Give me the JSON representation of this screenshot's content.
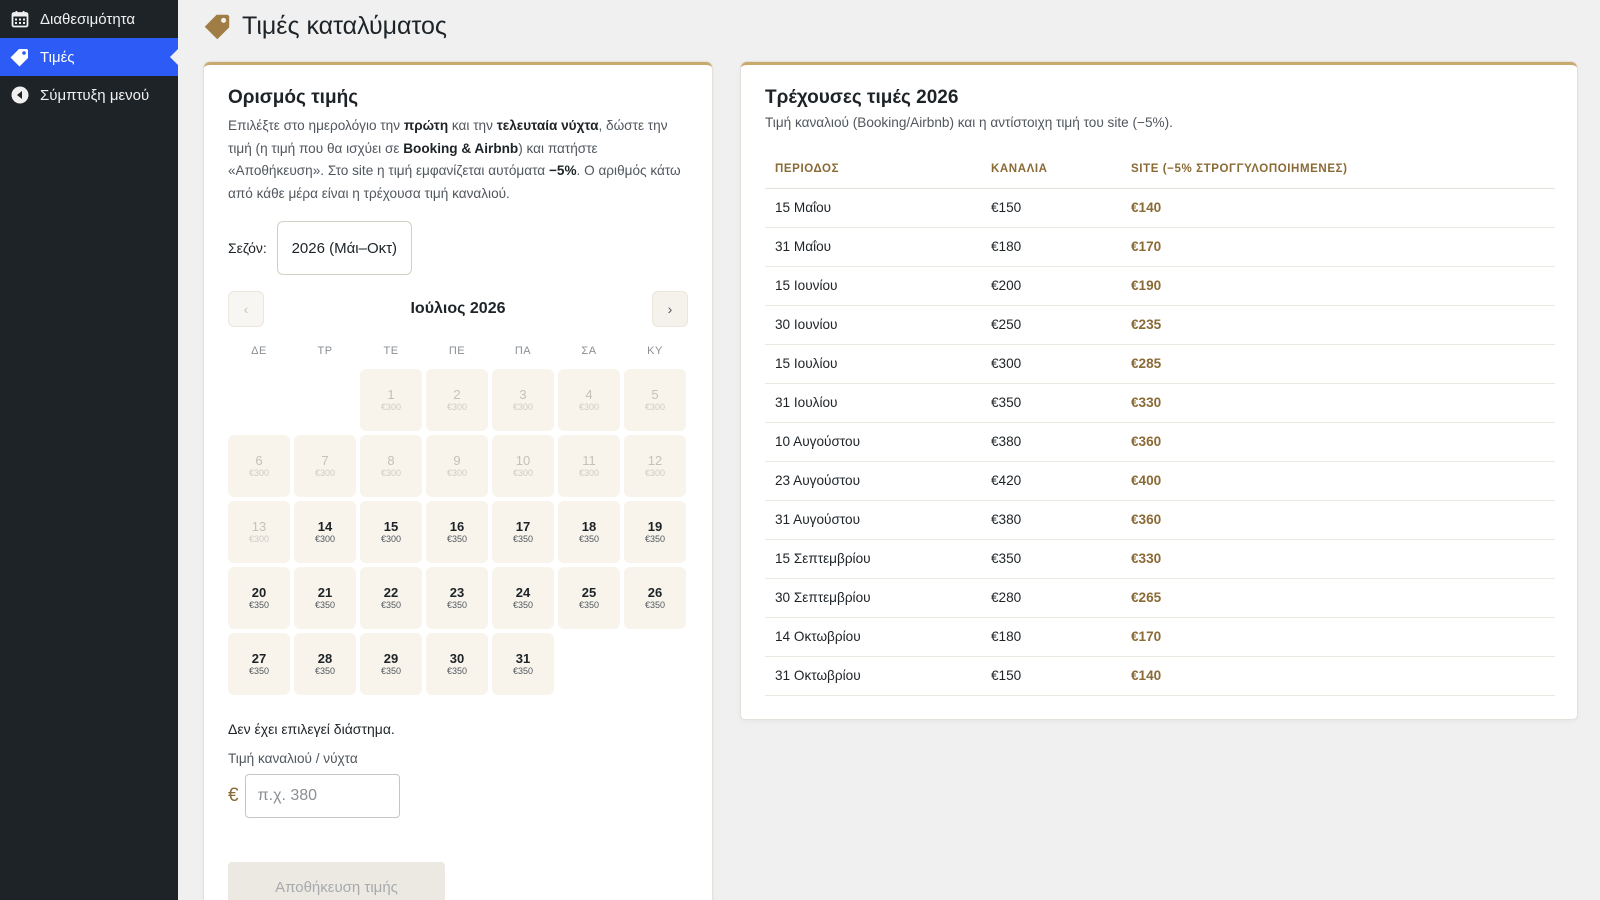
{
  "sidebar": {
    "items": [
      {
        "label": "Διαθεσιμότητα",
        "icon": "calendar-icon",
        "active": false
      },
      {
        "label": "Τιμές",
        "icon": "tag-icon",
        "active": true
      },
      {
        "label": "Σύμπτυξη μενού",
        "icon": "collapse-icon",
        "active": false
      }
    ]
  },
  "header": {
    "title": "Τιμές καταλύματος",
    "icon": "tag-icon"
  },
  "left_card": {
    "title": "Ορισμός τιμής",
    "desc_parts": [
      "Επιλέξτε στο ημερολόγιο την ",
      "πρώτη",
      " και την ",
      "τελευταία νύχτα",
      ", δώστε την τιμή (η τιμή που θα ισχύει σε ",
      "Booking & Airbnb",
      ") και πατήστε «Αποθήκευση». Στο site η τιμή εμφανίζεται αυτόματα ",
      "−5%",
      ". Ο αριθμός κάτω από κάθε μέρα είναι η τρέχουσα τιμή καναλιού."
    ],
    "season_label": "Σεζόν:",
    "season_value": "2026 (Μάι–Οκτ)",
    "prev_label": "‹",
    "next_label": "›",
    "month_label": "Ιούλιος 2026",
    "weekdays": [
      "ΔΕ",
      "ΤΡ",
      "ΤΕ",
      "ΠΕ",
      "ΠΑ",
      "ΣΑ",
      "ΚΥ"
    ],
    "leading_blanks": 2,
    "days": [
      {
        "d": "1",
        "p": "€300",
        "past": true
      },
      {
        "d": "2",
        "p": "€300",
        "past": true
      },
      {
        "d": "3",
        "p": "€300",
        "past": true
      },
      {
        "d": "4",
        "p": "€300",
        "past": true
      },
      {
        "d": "5",
        "p": "€300",
        "past": true
      },
      {
        "d": "6",
        "p": "€300",
        "past": true
      },
      {
        "d": "7",
        "p": "€300",
        "past": true
      },
      {
        "d": "8",
        "p": "€300",
        "past": true
      },
      {
        "d": "9",
        "p": "€300",
        "past": true
      },
      {
        "d": "10",
        "p": "€300",
        "past": true
      },
      {
        "d": "11",
        "p": "€300",
        "past": true
      },
      {
        "d": "12",
        "p": "€300",
        "past": true
      },
      {
        "d": "13",
        "p": "€300",
        "past": true
      },
      {
        "d": "14",
        "p": "€300",
        "past": false
      },
      {
        "d": "15",
        "p": "€300",
        "past": false
      },
      {
        "d": "16",
        "p": "€350",
        "past": false
      },
      {
        "d": "17",
        "p": "€350",
        "past": false
      },
      {
        "d": "18",
        "p": "€350",
        "past": false
      },
      {
        "d": "19",
        "p": "€350",
        "past": false
      },
      {
        "d": "20",
        "p": "€350",
        "past": false
      },
      {
        "d": "21",
        "p": "€350",
        "past": false
      },
      {
        "d": "22",
        "p": "€350",
        "past": false
      },
      {
        "d": "23",
        "p": "€350",
        "past": false
      },
      {
        "d": "24",
        "p": "€350",
        "past": false
      },
      {
        "d": "25",
        "p": "€350",
        "past": false
      },
      {
        "d": "26",
        "p": "€350",
        "past": false
      },
      {
        "d": "27",
        "p": "€350",
        "past": false
      },
      {
        "d": "28",
        "p": "€350",
        "past": false
      },
      {
        "d": "29",
        "p": "€350",
        "past": false
      },
      {
        "d": "30",
        "p": "€350",
        "past": false
      },
      {
        "d": "31",
        "p": "€350",
        "past": false
      }
    ],
    "selection_status": "Δεν έχει επιλεγεί διάστημα.",
    "price_label": "Τιμή καναλιού / νύχτα",
    "currency": "€",
    "price_placeholder": "π.χ. 380",
    "save_label": "Αποθήκευση τιμής"
  },
  "right_card": {
    "title": "Τρέχουσες τιμές 2026",
    "subtitle": "Τιμή καναλιού (Booking/Airbnb) και η αντίστοιχη τιμή του site (−5%).",
    "columns": [
      "ΠΕΡΙΟΔΟΣ",
      "ΚΑΝΑΛΙΑ",
      "SITE (−5% ΣΤΡΟΓΓΥΛΟΠΟΙΗΜΕΝΕΣ)"
    ],
    "rows": [
      {
        "period": "15 Μαΐου",
        "channel": "€150",
        "site": "€140"
      },
      {
        "period": "31 Μαΐου",
        "channel": "€180",
        "site": "€170"
      },
      {
        "period": "15 Ιουνίου",
        "channel": "€200",
        "site": "€190"
      },
      {
        "period": "30 Ιουνίου",
        "channel": "€250",
        "site": "€235"
      },
      {
        "period": "15 Ιουλίου",
        "channel": "€300",
        "site": "€285"
      },
      {
        "period": "31 Ιουλίου",
        "channel": "€350",
        "site": "€330"
      },
      {
        "period": "10 Αυγούστου",
        "channel": "€380",
        "site": "€360"
      },
      {
        "period": "23 Αυγούστου",
        "channel": "€420",
        "site": "€400"
      },
      {
        "period": "31 Αυγούστου",
        "channel": "€380",
        "site": "€360"
      },
      {
        "period": "15 Σεπτεμβρίου",
        "channel": "€350",
        "site": "€330"
      },
      {
        "period": "30 Σεπτεμβρίου",
        "channel": "€280",
        "site": "€265"
      },
      {
        "period": "14 Οκτωβρίου",
        "channel": "€180",
        "site": "€170"
      },
      {
        "period": "31 Οκτωβρίου",
        "channel": "€150",
        "site": "€140"
      }
    ]
  },
  "colors": {
    "sidebar_bg": "#1d2327",
    "active_bg": "#2c5cf5",
    "accent_gold": "#c9a96e",
    "site_price": "#8a6a35"
  }
}
